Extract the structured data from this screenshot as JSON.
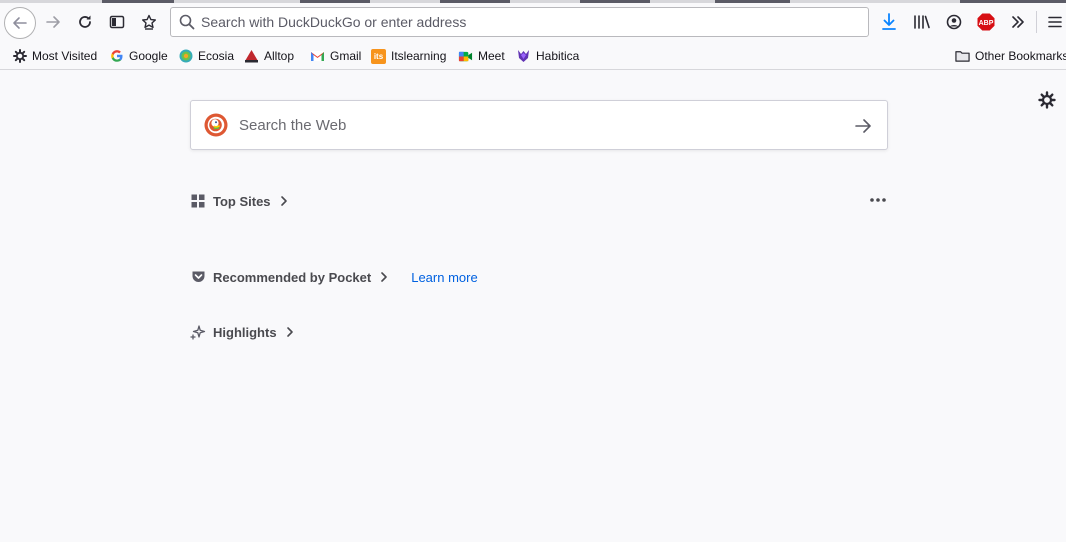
{
  "urlbar": {
    "placeholder": "Search with DuckDuckGo or enter address"
  },
  "bookmarks": [
    {
      "label": "Most Visited",
      "icon": "gear-icon"
    },
    {
      "label": "Google",
      "icon": "google-icon"
    },
    {
      "label": "Ecosia",
      "icon": "ecosia-icon"
    },
    {
      "label": "Alltop",
      "icon": "alltop-icon"
    },
    {
      "label": "Gmail",
      "icon": "gmail-icon"
    },
    {
      "label": "Itslearning",
      "icon": "itslearning-icon"
    },
    {
      "label": "Meet",
      "icon": "meet-icon"
    },
    {
      "label": "Habitica",
      "icon": "habitica-icon"
    }
  ],
  "other_bookmarks": {
    "label": "Other Bookmarks",
    "icon": "folder-icon"
  },
  "newtab": {
    "search_placeholder": "Search the Web",
    "top_sites": "Top Sites",
    "pocket": "Recommended by Pocket",
    "learn_more": "Learn more",
    "highlights": "Highlights"
  },
  "extensions": {
    "abp_label": "ABP"
  },
  "favicon_text": {
    "itslearning": "its"
  },
  "colors": {
    "accent_blue": "#0061e0",
    "download_blue": "#0a84ff",
    "abp_red": "#d70f14",
    "itslearning_orange": "#f7941d"
  }
}
